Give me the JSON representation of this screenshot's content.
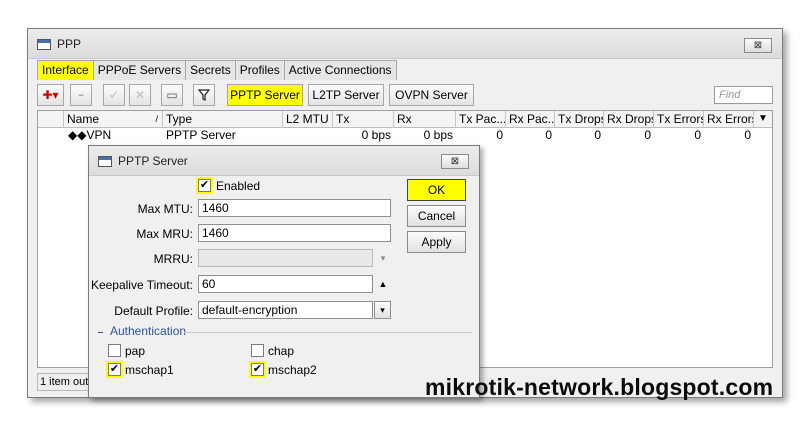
{
  "window": {
    "title": "PPP",
    "close_label": "⊠"
  },
  "tabs": [
    {
      "label": "Interface",
      "active": true
    },
    {
      "label": "PPPoE Servers"
    },
    {
      "label": "Secrets"
    },
    {
      "label": "Profiles"
    },
    {
      "label": "Active Connections"
    }
  ],
  "toolbar": {
    "add_label": "✚▾",
    "remove_label": "━",
    "enable_label": "✓",
    "disable_label": "✕",
    "comment_label": "▭",
    "filter_label": "▼",
    "pptp_server_label": "PPTP Server",
    "l2tp_server_label": "L2TP Server",
    "ovpn_server_label": "OVPN Server",
    "find_placeholder": "Find"
  },
  "table": {
    "columns": [
      "Name",
      "Type",
      "L2 MTU",
      "Tx",
      "Rx",
      "Tx Pac...",
      "Rx Pac...",
      "Tx Drops",
      "Rx Drops",
      "Tx Errors",
      "Rx Errors"
    ],
    "sort_indicator": "/",
    "menu_arrow": "▼",
    "rows": [
      {
        "name": "◆◆VPN",
        "type": "PPTP Server",
        "l2mtu": "",
        "tx": "0 bps",
        "rx": "0 bps",
        "tx_pac": "0",
        "rx_pac": "0",
        "tx_drops": "0",
        "rx_drops": "0",
        "tx_errors": "0",
        "rx_errors": "0"
      }
    ],
    "status": "1 item out"
  },
  "dialog": {
    "title": "PPTP Server",
    "close_label": "⊠",
    "enabled_label": "Enabled",
    "enabled_check": "✔",
    "max_mtu_label": "Max MTU:",
    "max_mtu_value": "1460",
    "max_mru_label": "Max MRU:",
    "max_mru_value": "1460",
    "mrru_label": "MRRU:",
    "mrru_value": "",
    "mrru_spin": "▾",
    "keepalive_label": "Keepalive Timeout:",
    "keepalive_value": "60",
    "keepalive_spin": "▲",
    "default_profile_label": "Default Profile:",
    "default_profile_value": "default-encryption",
    "default_profile_arrow": "▾",
    "auth_section_label": "Authentication",
    "auth": [
      {
        "label": "pap",
        "checked": false,
        "check": ""
      },
      {
        "label": "chap",
        "checked": false,
        "check": ""
      },
      {
        "label": "mschap1",
        "checked": true,
        "check": "✔"
      },
      {
        "label": "mschap2",
        "checked": true,
        "check": "✔"
      }
    ],
    "ok_label": "OK",
    "cancel_label": "Cancel",
    "apply_label": "Apply"
  },
  "watermark": "mikrotik-network.blogspot.com",
  "colors": {
    "highlight": "#ffff00",
    "section": "#2d52a8"
  }
}
